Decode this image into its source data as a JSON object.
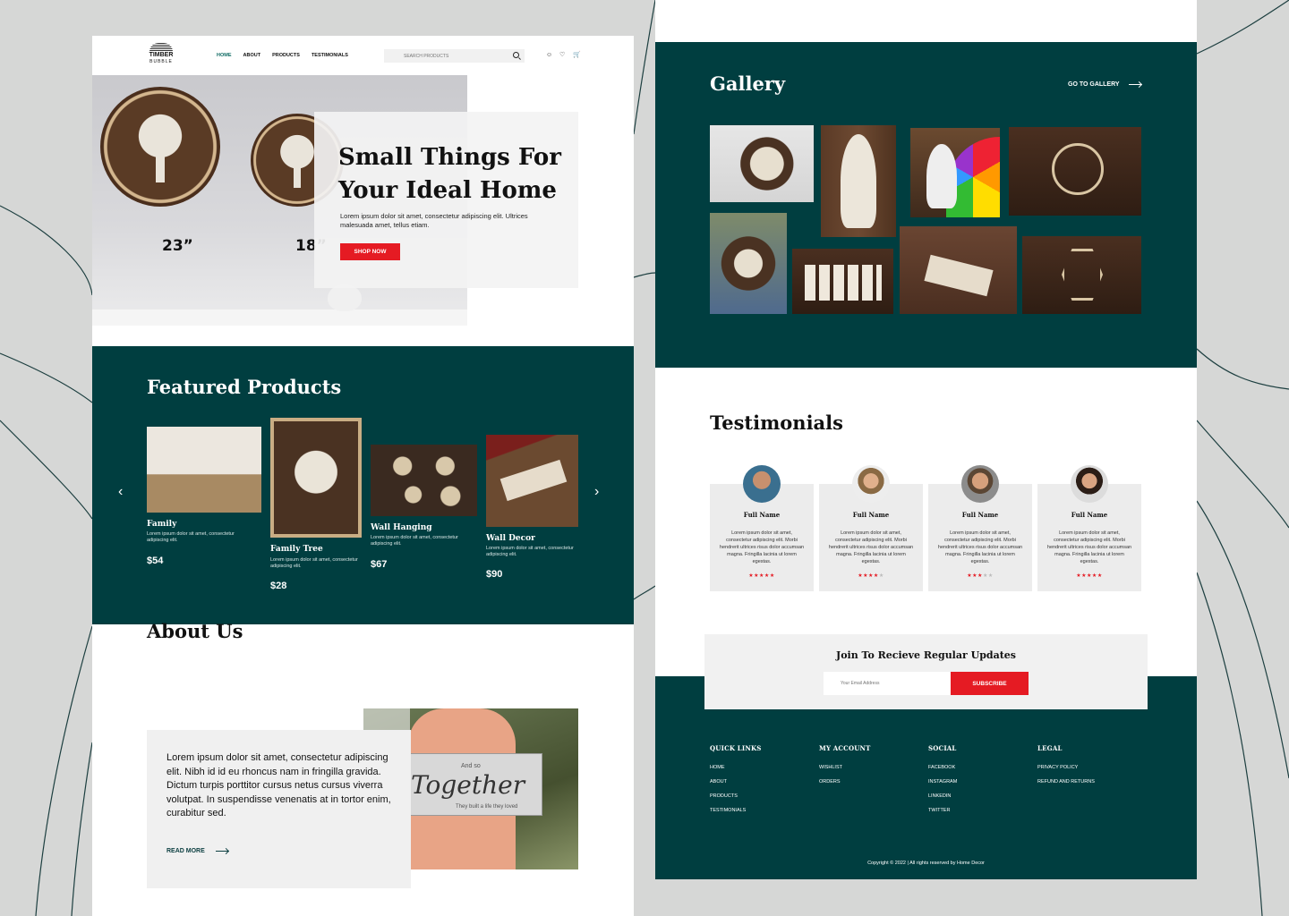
{
  "brand": {
    "line1": "TIMBER",
    "line2": "BUBBLE"
  },
  "nav": {
    "items": [
      "HOME",
      "ABOUT",
      "PRODUCTS",
      "TESTIMONIALS"
    ],
    "active": "HOME"
  },
  "search": {
    "placeholder": "SEARCH PRODUCTS"
  },
  "header_icons": [
    "user-icon",
    "heart-icon",
    "cart-icon"
  ],
  "hero": {
    "title": "Small Things For Your Ideal Home",
    "text": "Lorem ipsum dolor sit amet, consectetur adipiscing elit. Ultrices malesuada amet, tellus etiam.",
    "button": "SHOP NOW",
    "size_labels": [
      "23”",
      "18”"
    ]
  },
  "featured": {
    "title": "Featured Products",
    "products": [
      {
        "name": "Family",
        "desc": "Lorem ipsum dolor sit amet, consectetur adipiscing elit.",
        "price": "$54"
      },
      {
        "name": "Family Tree",
        "desc": "Lorem ipsum dolor sit amet, consectetur adipiscing elit.",
        "price": "$28"
      },
      {
        "name": "Wall Hanging",
        "desc": "Lorem ipsum dolor sit amet, consectetur adipiscing elit.",
        "price": "$67"
      },
      {
        "name": "Wall Decor",
        "desc": "Lorem ipsum dolor sit amet, consectetur adipiscing elit.",
        "price": "$90"
      }
    ]
  },
  "about": {
    "title": "About Us",
    "text": "Lorem ipsum dolor sit amet, consectetur adipiscing elit. Nibh id id eu rhoncus nam in fringilla gravida. Dictum turpis porttitor cursus netus cursus viverra volutpat. In suspendisse venenatis at in tortor enim, curabitur sed.",
    "link": "READ MORE",
    "sign": {
      "small": "And so",
      "big": "Together",
      "caption": "They built a life they loved"
    }
  },
  "gallery": {
    "title": "Gallery",
    "link": "GO TO GALLERY"
  },
  "testimonials": {
    "title": "Testimonials",
    "items": [
      {
        "name": "Full Name",
        "text": "Lorem ipsum dolor sit amet, consectetur adipiscing elit. Morbi hendrerit ultrices risus dolor accumsan magna. Fringilla lacinia ut lorem egestas.",
        "stars": 5
      },
      {
        "name": "Full Name",
        "text": "Lorem ipsum dolor sit amet, consectetur adipiscing elit. Morbi hendrerit ultrices risus dolor accumsan magna. Fringilla lacinia ut lorem egestas.",
        "stars": 4
      },
      {
        "name": "Full Name",
        "text": "Lorem ipsum dolor sit amet, consectetur adipiscing elit. Morbi hendrerit ultrices risus dolor accumsan magna. Fringilla lacinia ut lorem egestas.",
        "stars": 3
      },
      {
        "name": "Full Name",
        "text": "Lorem ipsum dolor sit amet, consectetur adipiscing elit. Morbi hendrerit ultrices risus dolor accumsan magna. Fringilla lacinia ut lorem egestas.",
        "stars": 5
      }
    ]
  },
  "newsletter": {
    "title": "Join To Recieve Regular Updates",
    "placeholder": "Your Email Address",
    "button": "SUBSCRIBE"
  },
  "footer": {
    "columns": [
      {
        "title": "QUICK LINKS",
        "links": [
          "HOME",
          "ABOUT",
          "PRODUCTS",
          "TESTIMONIALS"
        ]
      },
      {
        "title": "MY ACCOUNT",
        "links": [
          "WISHLIST",
          "ORDERS"
        ]
      },
      {
        "title": "SOCIAL",
        "links": [
          "FACEBOOK",
          "INSTAGRAM",
          "LINKEDIN",
          "TWITTER"
        ]
      },
      {
        "title": "LEGAL",
        "links": [
          "PRIVACY POLICY",
          "REFUND AND RETURNS"
        ]
      }
    ],
    "copyright": "Copyright © 2022 | All rights reserved by Home Decor"
  },
  "colors": {
    "teal": "#003e40",
    "accent": "#e51b23",
    "background": "#d6d7d6"
  }
}
